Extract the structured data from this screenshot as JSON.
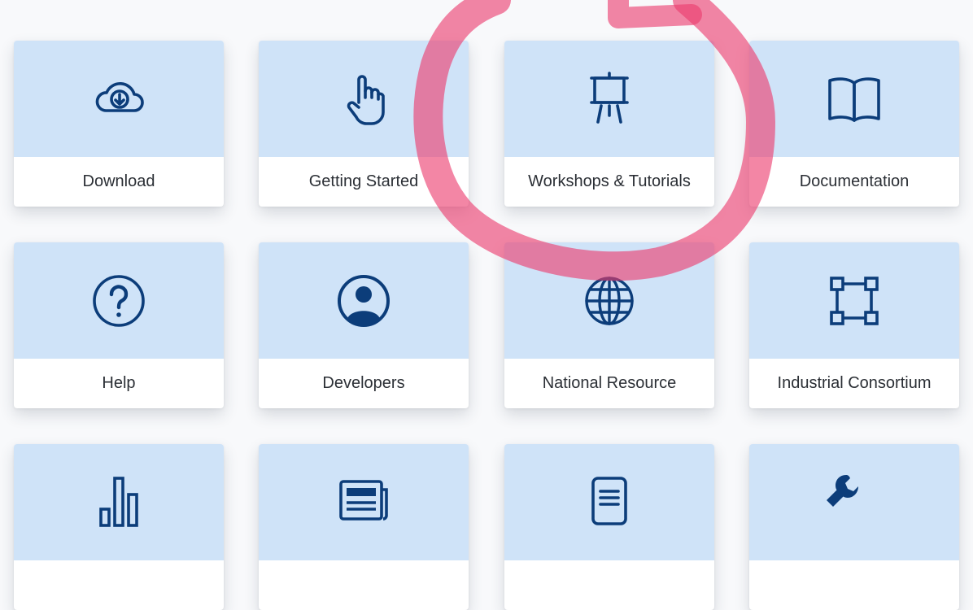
{
  "colors": {
    "icon_area_bg": "#cfe3f8",
    "icon_stroke": "#0c3d7a",
    "label_text": "#2b2f35",
    "page_bg": "#f8f9fb",
    "annotation_circle": "#ec3c6e"
  },
  "tiles": [
    {
      "label": "Download",
      "icon": "cloud-download-icon"
    },
    {
      "label": "Getting Started",
      "icon": "pointing-hand-icon"
    },
    {
      "label": "Workshops & Tutorials",
      "icon": "presentation-easel-icon"
    },
    {
      "label": "Documentation",
      "icon": "open-book-icon"
    },
    {
      "label": "Help",
      "icon": "question-circle-icon"
    },
    {
      "label": "Developers",
      "icon": "user-circle-icon"
    },
    {
      "label": "National Resource",
      "icon": "globe-icon"
    },
    {
      "label": "Industrial Consortium",
      "icon": "connected-squares-icon"
    },
    {
      "label": "",
      "icon": "bar-chart-icon"
    },
    {
      "label": "",
      "icon": "newspaper-icon"
    },
    {
      "label": "",
      "icon": "document-icon"
    },
    {
      "label": "",
      "icon": "wrench-icon"
    }
  ],
  "annotation": {
    "shape": "hand-drawn-circle",
    "target": "Workshops & Tutorials"
  }
}
